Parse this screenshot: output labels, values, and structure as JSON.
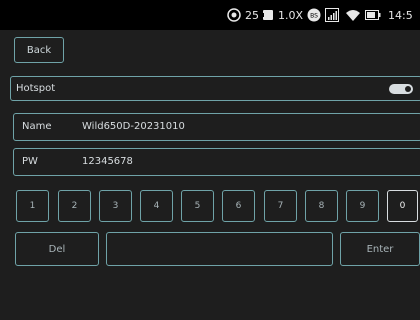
{
  "status_bar": {
    "icons": [
      "location-icon",
      "battery-bolt-icon",
      "bluetooth-icon",
      "signal-icon",
      "wifi-icon",
      "battery-icon"
    ],
    "value": "25",
    "zoom": "1.0X",
    "bluetooth_label": "BS",
    "time": "14:5"
  },
  "back": {
    "label": "Back"
  },
  "hotspot": {
    "label": "Hotspot",
    "toggle_on": true
  },
  "name_field": {
    "label": "Name",
    "value": "Wild650D-20231010"
  },
  "pw_field": {
    "label": "PW",
    "value": "12345678"
  },
  "keypad": {
    "keys": [
      "1",
      "2",
      "3",
      "4",
      "5",
      "6",
      "7",
      "8",
      "9",
      "0"
    ],
    "selected": "0",
    "del_label": "Del",
    "enter_label": "Enter"
  },
  "colors": {
    "background": "#1e1e1e",
    "status_bar": "#000000",
    "border": "#6fa3a8",
    "selected_border": "#d8dde0"
  }
}
